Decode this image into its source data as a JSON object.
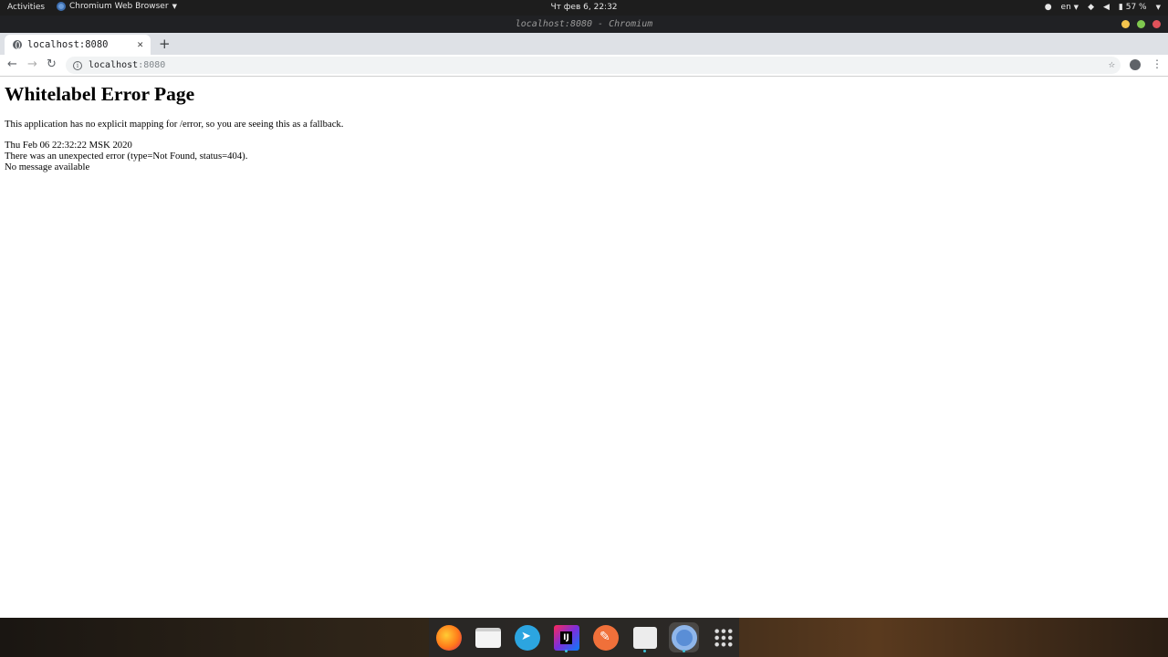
{
  "topbar": {
    "activities": "Activities",
    "app_name": "Chromium Web Browser",
    "clock": "Чт фев  6, 22:32",
    "language": "en",
    "battery": "57 %"
  },
  "window": {
    "title": "localhost:8080 - Chromium",
    "buttons": {
      "minimize_color": "#f4c44d",
      "maximize_color": "#7fc84f",
      "close_color": "#e0525a"
    }
  },
  "tab": {
    "title": "localhost:8080"
  },
  "address": {
    "host": "localhost",
    "port": ":8080"
  },
  "page": {
    "heading": "Whitelabel Error Page",
    "message": "This application has no explicit mapping for /error, so you are seeing this as a fallback.",
    "timestamp": "Thu Feb 06 22:32:22 MSK 2020",
    "error": "There was an unexpected error (type=Not Found, status=404).",
    "detail": "No message available"
  },
  "dock": {
    "items": [
      "firefox-icon",
      "files-icon",
      "telegram-icon",
      "intellij-idea-icon",
      "text-editor-icon",
      "ubuntu-software-icon",
      "chromium-icon",
      "show-applications-icon"
    ],
    "idea_label": "IJ"
  }
}
